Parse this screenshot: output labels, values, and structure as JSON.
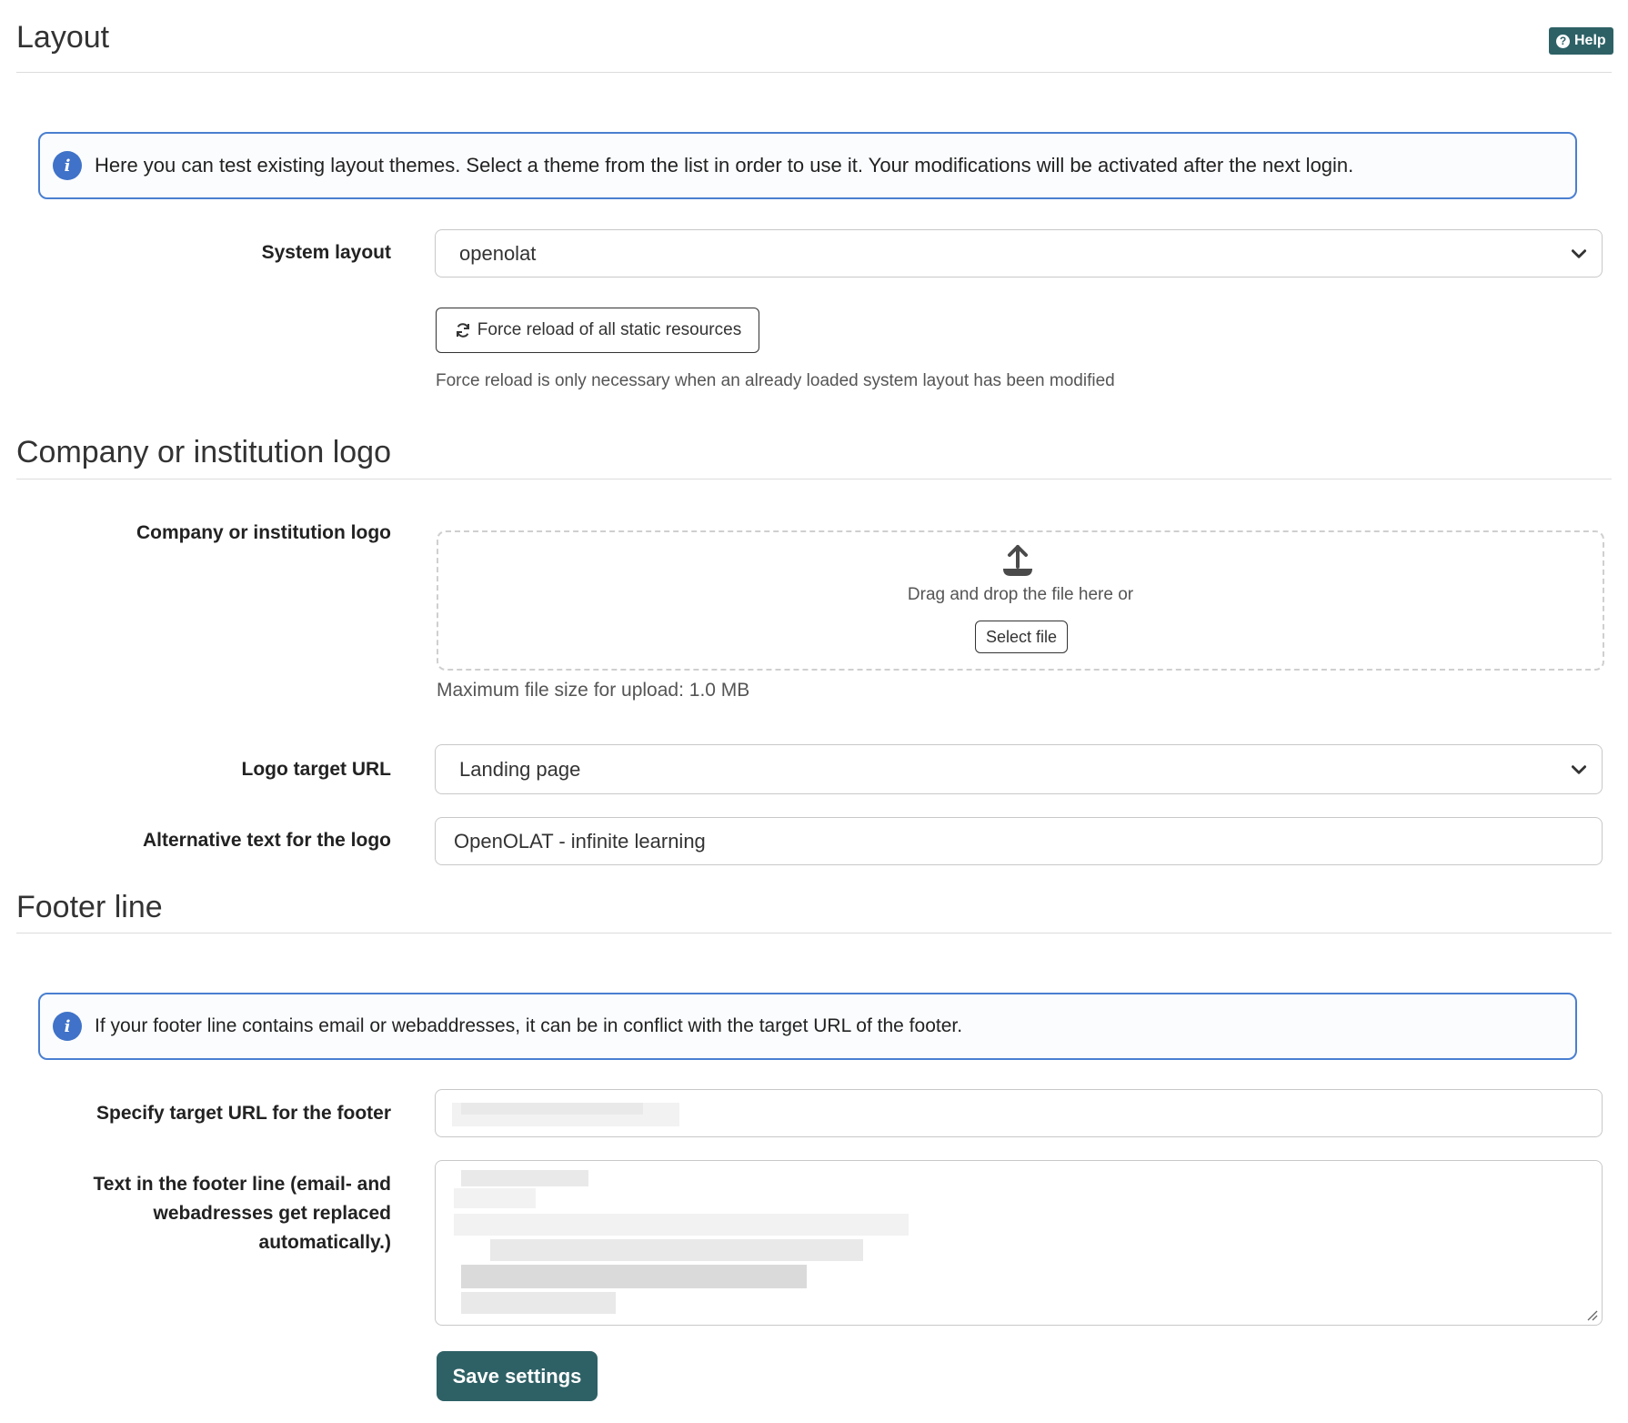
{
  "layout_section": {
    "title": "Layout",
    "help_label": "Help",
    "info_text": "Here you can test existing layout themes. Select a theme from the list in order to use it. Your modifications will be activated after the next login.",
    "system_layout_label": "System layout",
    "system_layout_value": "openolat",
    "force_reload_label": "Force reload of all static resources",
    "force_reload_hint": "Force reload is only necessary when an already loaded system layout has been modified"
  },
  "logo_section": {
    "title": "Company or institution logo",
    "logo_label": "Company or institution logo",
    "dropzone_text": "Drag and drop the file here or",
    "select_file_label": "Select file",
    "max_size_text": "Maximum file size for upload: 1.0 MB",
    "target_url_label": "Logo target URL",
    "target_url_value": "Landing page",
    "alt_text_label": "Alternative text for the logo",
    "alt_text_value": "OpenOLAT - infinite learning"
  },
  "footer_section": {
    "title": "Footer line",
    "info_text": "If your footer line contains email or webaddresses, it can be in conflict with the target URL of the footer.",
    "target_url_label": "Specify target URL for the footer",
    "footer_text_label_line1": "Text in the footer line (email- and",
    "footer_text_label_line2": "webadresses get replaced",
    "footer_text_label_line3": "automatically.)",
    "save_label": "Save settings"
  },
  "colors": {
    "accent": "#2e6166",
    "info_border": "#4a7fd0",
    "info_icon": "#3f72c8"
  }
}
